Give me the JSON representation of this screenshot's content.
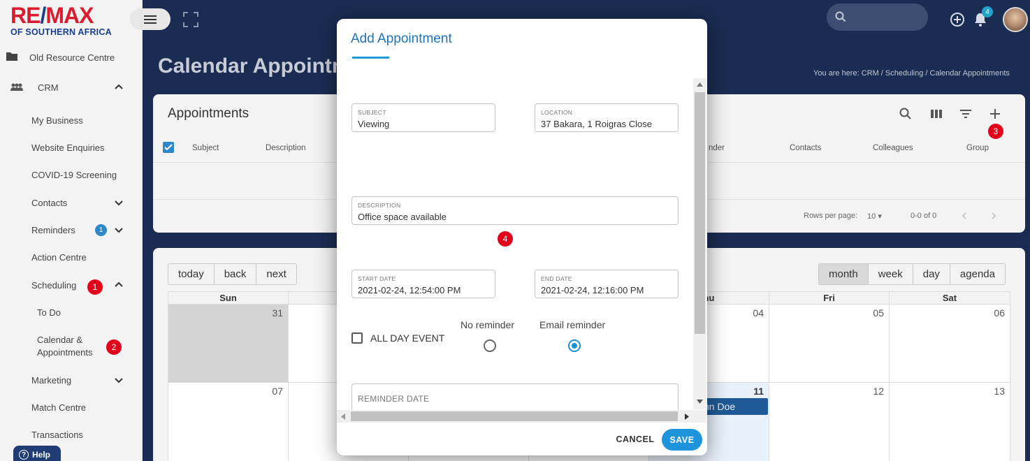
{
  "logo": {
    "main_left": "RE",
    "main_slash": "/",
    "main_right": "MAX",
    "sub": "OF SOUTHERN AFRICA"
  },
  "sidebar": {
    "items": [
      {
        "label": "Old Resource Centre"
      },
      {
        "label": "CRM"
      },
      {
        "label": "My Business"
      },
      {
        "label": "Website Enquiries"
      },
      {
        "label": "COVID-19 Screening"
      },
      {
        "label": "Contacts"
      },
      {
        "label": "Reminders",
        "badge": "1"
      },
      {
        "label": "Action Centre"
      },
      {
        "label": "Scheduling"
      },
      {
        "label": "To Do"
      },
      {
        "label": "Calendar &",
        "label2": "Appointments"
      },
      {
        "label": "Marketing"
      },
      {
        "label": "Match Centre"
      },
      {
        "label": "Transactions"
      }
    ],
    "help": "Help"
  },
  "topbar": {
    "notification_count": "4"
  },
  "page": {
    "title": "Calendar Appointments",
    "breadcrumb": "You are here:  CRM /  Scheduling /  Calendar Appointments"
  },
  "appointments": {
    "title": "Appointments",
    "columns": [
      "Subject",
      "Description",
      "nder",
      "Contacts",
      "Colleagues",
      "Group"
    ],
    "rows_per_page_label": "Rows per page:",
    "rows_per_page_value": "10",
    "range": "0-0 of 0"
  },
  "calendar": {
    "nav_buttons": [
      "today",
      "back",
      "next"
    ],
    "view_buttons": [
      "month",
      "week",
      "day",
      "agenda"
    ],
    "active_view": "month",
    "day_headers": [
      "Sun",
      "",
      "",
      "",
      "hu",
      "Fri",
      "Sat"
    ],
    "week1": [
      "31",
      "",
      "",
      "",
      "04",
      "05",
      "06"
    ],
    "week2": [
      "07",
      "",
      "",
      "",
      "11",
      "12",
      "13"
    ],
    "event": "hn Doe"
  },
  "annotations": [
    "1",
    "2",
    "3",
    "4"
  ],
  "modal": {
    "title": "Add Appointment",
    "subject": {
      "label": "SUBJECT",
      "value": "Viewing"
    },
    "location": {
      "label": "LOCATION",
      "value": "37 Bakara, 1 Roigras Close"
    },
    "description": {
      "label": "DESCRIPTION",
      "value": "Office space available"
    },
    "start_date": {
      "label": "START DATE",
      "value": "2021-02-24, 12:54:00 PM"
    },
    "end_date": {
      "label": "END DATE",
      "value": "2021-02-24, 12:16:00 PM"
    },
    "all_day": "ALL DAY EVENT",
    "no_reminder": "No reminder",
    "email_reminder": "Email reminder",
    "selected_reminder": "Email reminder",
    "reminder_date": {
      "placeholder": "REMINDER DATE"
    },
    "cancel": "CANCEL",
    "save": "SAVE"
  },
  "colors": {
    "navy": "#1b2c52",
    "primary_blue": "#1e94dc",
    "annotation_red": "#e3001b",
    "remax_red": "#dc1c2e",
    "remax_blue": "#1a3e8c"
  }
}
